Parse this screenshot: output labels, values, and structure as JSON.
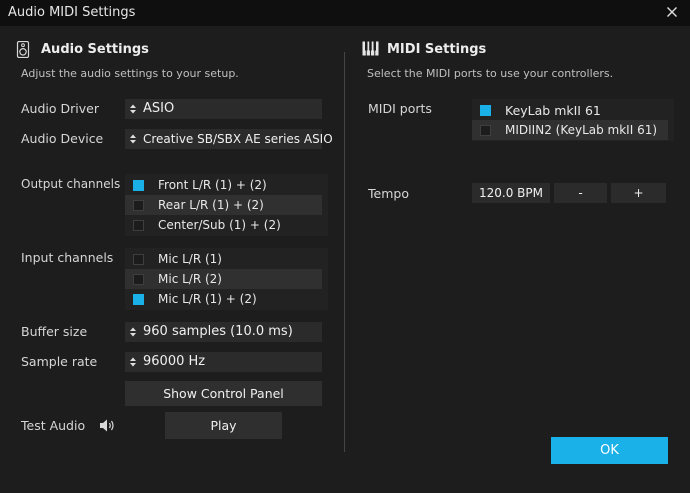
{
  "window": {
    "title": "Audio MIDI Settings"
  },
  "audio": {
    "heading": "Audio Settings",
    "subtitle": "Adjust the audio settings to your setup.",
    "driver_label": "Audio Driver",
    "driver_value": "ASIO",
    "device_label": "Audio Device",
    "device_value": "Creative SB/SBX AE series ASIO",
    "output_label": "Output channels",
    "output_channels": [
      {
        "label": "Front L/R (1) + (2)",
        "checked": true
      },
      {
        "label": "Rear L/R (1) + (2)",
        "checked": false
      },
      {
        "label": "Center/Sub (1) + (2)",
        "checked": false
      }
    ],
    "input_label": "Input channels",
    "input_channels": [
      {
        "label": "Mic L/R (1)",
        "checked": false
      },
      {
        "label": "Mic L/R (2)",
        "checked": false
      },
      {
        "label": "Mic L/R (1) + (2)",
        "checked": true
      }
    ],
    "buffer_label": "Buffer size",
    "buffer_value": "960 samples (10.0 ms)",
    "rate_label": "Sample rate",
    "rate_value": "96000 Hz",
    "control_panel_button": "Show Control Panel",
    "test_label": "Test Audio",
    "play_button": "Play"
  },
  "midi": {
    "heading": "MIDI Settings",
    "subtitle": "Select the MIDI ports to use your controllers.",
    "ports_label": "MIDI ports",
    "ports": [
      {
        "label": "KeyLab mkII 61",
        "checked": true
      },
      {
        "label": "MIDIIN2 (KeyLab mkII 61)",
        "checked": false
      }
    ],
    "tempo_label": "Tempo",
    "tempo_value": "120.0 BPM",
    "tempo_minus": "-",
    "tempo_plus": "+"
  },
  "ok_button": "OK",
  "colors": {
    "accent": "#1ab0e8",
    "background": "#1d1d1d",
    "titlebar": "#0f0f0f"
  }
}
